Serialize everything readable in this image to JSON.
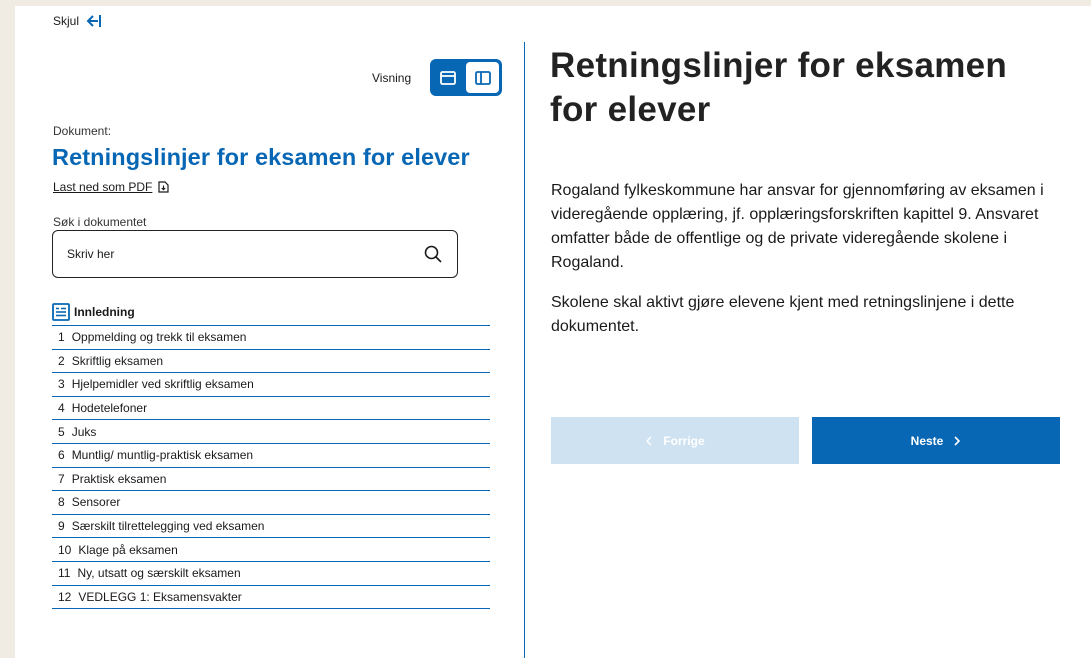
{
  "sidebar": {
    "hide_label": "Skjul",
    "view_label": "Visning",
    "doc_label": "Dokument:",
    "doc_title": "Retningslinjer for eksamen for elever",
    "pdf_label": "Last ned som PDF",
    "search_label": "Søk i dokumentet",
    "search_placeholder": "Skriv her",
    "toc_head": "Innledning",
    "toc": [
      {
        "num": "1",
        "label": "Oppmelding og trekk til eksamen"
      },
      {
        "num": "2",
        "label": "Skriftlig eksamen"
      },
      {
        "num": "3",
        "label": "Hjelpemidler ved skriftlig eksamen"
      },
      {
        "num": "4",
        "label": "Hodetelefoner"
      },
      {
        "num": "5",
        "label": "Juks"
      },
      {
        "num": "6",
        "label": "Muntlig/ muntlig-praktisk eksamen"
      },
      {
        "num": "7",
        "label": "Praktisk eksamen"
      },
      {
        "num": "8",
        "label": "Sensorer"
      },
      {
        "num": "9",
        "label": "Særskilt tilrettelegging ved eksamen"
      },
      {
        "num": "10",
        "label": "Klage på eksamen"
      },
      {
        "num": "11",
        "label": "Ny, utsatt og særskilt eksamen"
      },
      {
        "num": "12",
        "label": "VEDLEGG 1: Eksamensvakter"
      }
    ]
  },
  "main": {
    "title": "Retningslinjer for eksamen for elever",
    "paragraphs": [
      "Rogaland fylkeskommune har ansvar for gjennomføring av eksamen i videregående opplæring, jf. opplæringsforskriften kapittel 9.  Ansvaret omfatter både de offentlige og de private videregående skolene i Rogaland.",
      "Skolene skal aktivt gjøre elevene kjent med retningslinjene i dette dokumentet."
    ],
    "prev_label": "Forrige",
    "next_label": "Neste"
  },
  "colors": {
    "brand": "#0867b5",
    "prev_disabled": "#cfe2f1",
    "background": "#f0ece4"
  },
  "icons": [
    "arrow-left-bar-icon",
    "layout-top-icon",
    "layout-sidebar-icon",
    "pdf-download-icon",
    "search-icon",
    "document-list-icon",
    "chevron-left-icon",
    "chevron-right-icon"
  ]
}
